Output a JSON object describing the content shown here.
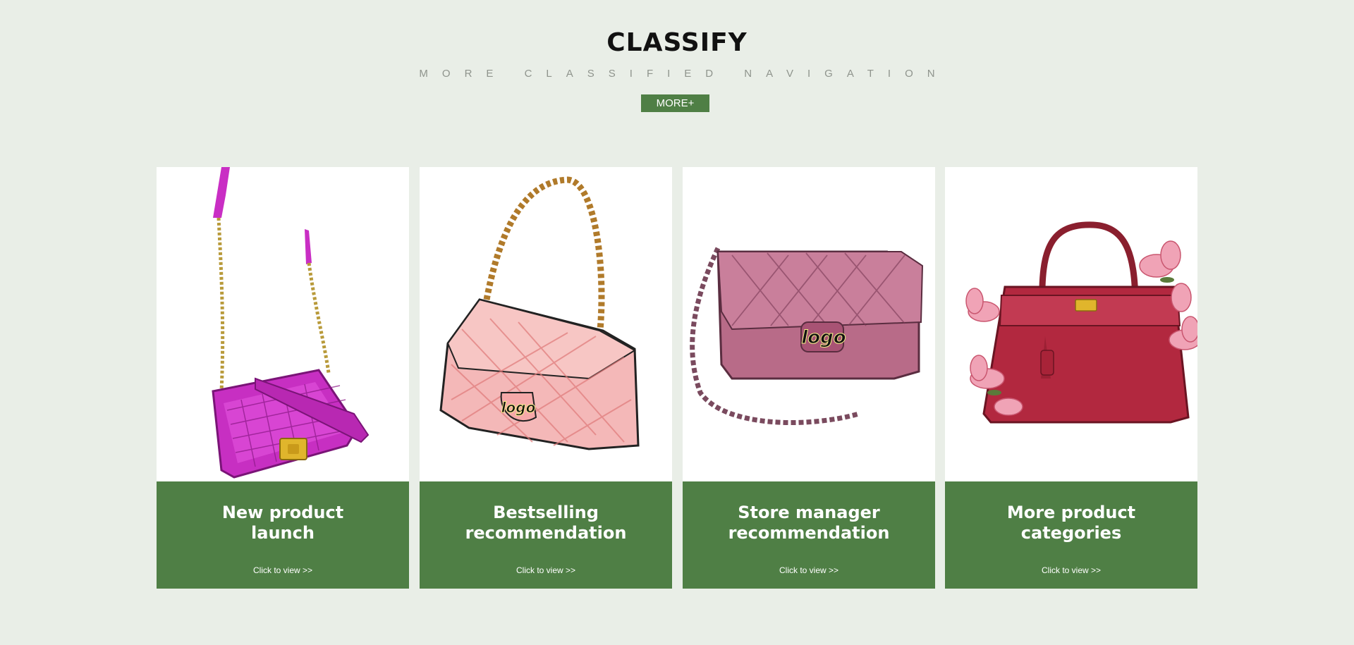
{
  "header": {
    "title": "CLASSIFY",
    "subtitle": "MORE CLASSIFIED NAVIGATION",
    "more_button": "MORE+"
  },
  "cards": [
    {
      "title_line1": "New product",
      "title_line2": "launch",
      "link": "Click to view >>",
      "image": "magenta-quilted-chain-bag-illustration"
    },
    {
      "title_line1": "Bestselling",
      "title_line2": "recommendation",
      "link": "Click to view >>",
      "image": "pink-quilted-flap-bag-illustration",
      "logo_text": "logo"
    },
    {
      "title_line1": "Store manager",
      "title_line2": "recommendation",
      "link": "Click to view >>",
      "image": "mauve-quilted-chain-bag-illustration",
      "logo_text": "logo"
    },
    {
      "title_line1": "More product",
      "title_line2": "categories",
      "link": "Click to view >>",
      "image": "red-top-handle-bag-with-flowers-illustration"
    }
  ],
  "colors": {
    "page_background": "#e9eee7",
    "accent_green": "#4f7f45",
    "title_text": "#111111",
    "subtitle_text": "#8f948d"
  }
}
